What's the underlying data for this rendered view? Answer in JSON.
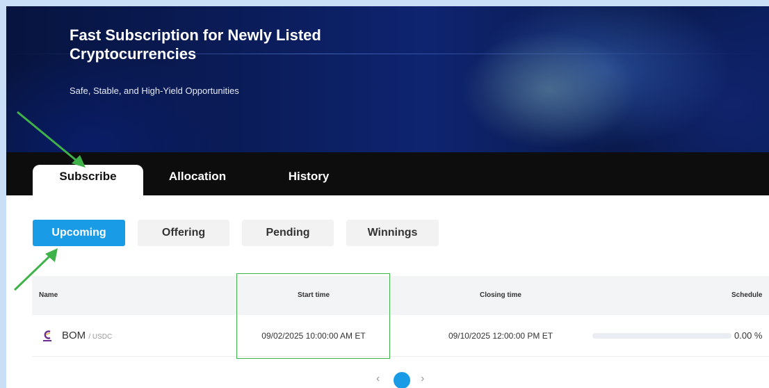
{
  "hero": {
    "title": "Fast Subscription for Newly Listed Cryptocurrencies",
    "subtitle": "Safe, Stable, and High-Yield Opportunities"
  },
  "tabs": [
    {
      "label": "Subscribe",
      "active": true
    },
    {
      "label": "Allocation",
      "active": false
    },
    {
      "label": "History",
      "active": false
    }
  ],
  "filters": [
    {
      "label": "Upcoming",
      "active": true
    },
    {
      "label": "Offering",
      "active": false
    },
    {
      "label": "Pending",
      "active": false
    },
    {
      "label": "Winnings",
      "active": false
    }
  ],
  "table": {
    "headers": {
      "name": "Name",
      "start_time": "Start time",
      "closing_time": "Closing time",
      "schedule": "Schedule"
    },
    "rows": [
      {
        "coin": "BOM",
        "quote": "/ USDC",
        "start_time": "09/02/2025 10:00:00 AM ET",
        "closing_time": "09/10/2025 12:00:00 PM ET",
        "progress_percent": 0,
        "progress_text": "0.00 %"
      }
    ]
  },
  "pagination": {
    "prev_label": "‹",
    "current_page": "1",
    "next_label": "›"
  },
  "colors": {
    "accent": "#1a9be6",
    "annotation": "#3fb24a",
    "tabbar": "#0d0d0d"
  }
}
